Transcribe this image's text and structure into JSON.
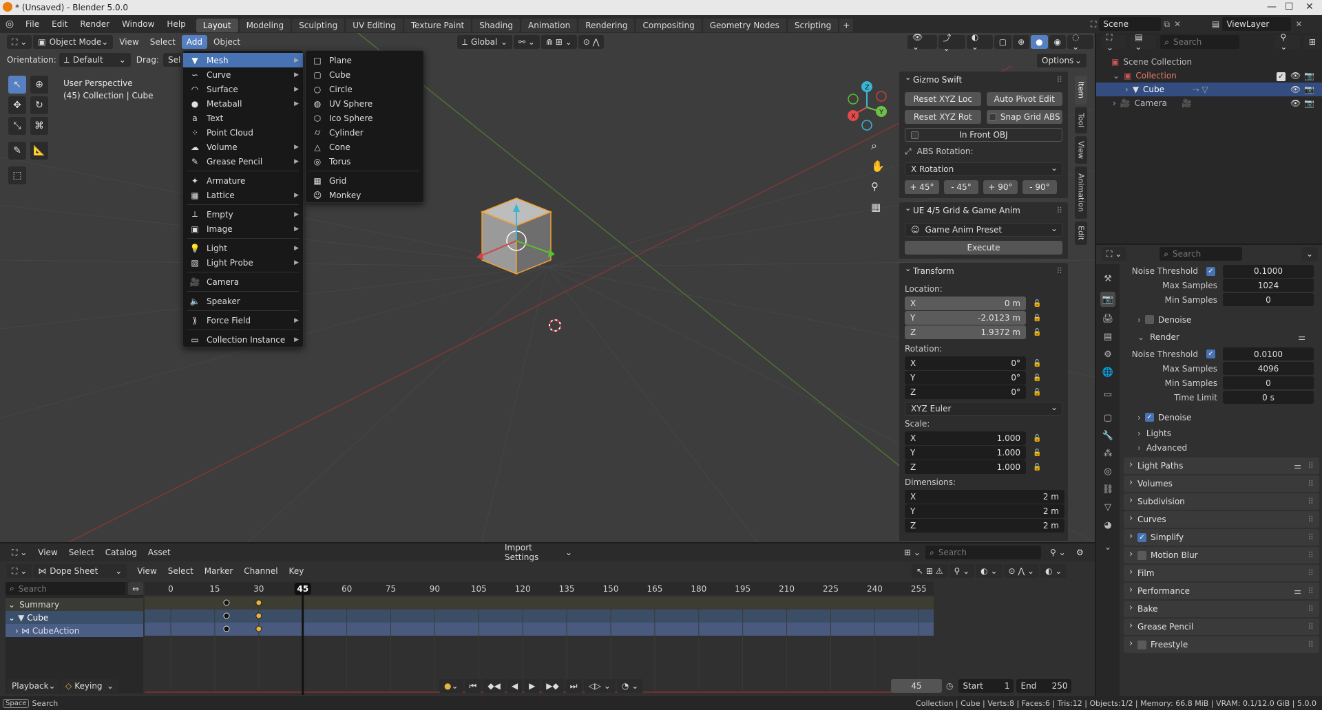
{
  "window": {
    "title": "* (Unsaved) - Blender 5.0.0"
  },
  "topbar": {
    "menus": [
      "File",
      "Edit",
      "Render",
      "Window",
      "Help"
    ],
    "workspaces": [
      "Layout",
      "Modeling",
      "Sculpting",
      "UV Editing",
      "Texture Paint",
      "Shading",
      "Animation",
      "Rendering",
      "Compositing",
      "Geometry Nodes",
      "Scripting"
    ],
    "scene": "Scene",
    "view_layer": "ViewLayer"
  },
  "viewport": {
    "mode": "Object Mode",
    "menus": [
      "View",
      "Select",
      "Add",
      "Object"
    ],
    "orientation_label": "Orientation:",
    "orientation_value": "Default",
    "drag_label": "Drag:",
    "drag_value": "Select",
    "transform_orientation": "Global",
    "options": "Options",
    "info_line1": "User Perspective",
    "info_line2": "(45) Collection | Cube"
  },
  "add_menu": {
    "items": [
      "Mesh",
      "Curve",
      "Surface",
      "Metaball",
      "Text",
      "Point Cloud",
      "Volume",
      "Grease Pencil",
      "Armature",
      "Lattice",
      "Empty",
      "Image",
      "Light",
      "Light Probe",
      "Camera",
      "Speaker",
      "Force Field",
      "Collection Instance"
    ]
  },
  "mesh_menu": {
    "items": [
      "Plane",
      "Cube",
      "Circle",
      "UV Sphere",
      "Ico Sphere",
      "Cylinder",
      "Cone",
      "Torus",
      "Grid",
      "Monkey"
    ]
  },
  "npanel": {
    "tabs": [
      "Item",
      "Tool",
      "View",
      "Animation",
      "Edit"
    ],
    "gizmo": {
      "title": "Gizmo Swift",
      "reset_loc": "Reset XYZ Loc",
      "auto_pivot": "Auto Pivot Edit",
      "reset_rot": "Reset XYZ Rot",
      "snap_grid": "Snap Grid ABS",
      "in_front": "In Front OBJ",
      "abs_rotation": "ABS Rotation:",
      "rotation_axis": "X Rotation",
      "angles": [
        "+ 45°",
        "- 45°",
        "+ 90°",
        "- 90°"
      ]
    },
    "ue": {
      "title": "UE 4/5 Grid & Game Anim",
      "preset": "Game Anim Preset",
      "execute": "Execute"
    },
    "transform": {
      "title": "Transform",
      "location_label": "Location:",
      "location": [
        {
          "axis": "X",
          "value": "0 m"
        },
        {
          "axis": "Y",
          "value": "-2.0123 m"
        },
        {
          "axis": "Z",
          "value": "1.9372 m"
        }
      ],
      "rotation_label": "Rotation:",
      "rotation": [
        {
          "axis": "X",
          "value": "0°"
        },
        {
          "axis": "Y",
          "value": "0°"
        },
        {
          "axis": "Z",
          "value": "0°"
        }
      ],
      "rotation_mode": "XYZ Euler",
      "scale_label": "Scale:",
      "scale": [
        {
          "axis": "X",
          "value": "1.000"
        },
        {
          "axis": "Y",
          "value": "1.000"
        },
        {
          "axis": "Z",
          "value": "1.000"
        }
      ],
      "dimensions_label": "Dimensions:",
      "dimensions": [
        {
          "axis": "X",
          "value": "2 m"
        },
        {
          "axis": "Y",
          "value": "2 m"
        },
        {
          "axis": "Z",
          "value": "2 m"
        }
      ]
    }
  },
  "outliner": {
    "search_placeholder": "Search",
    "scene_collection": "Scene Collection",
    "collection": "Collection",
    "cube": "Cube",
    "camera": "Camera"
  },
  "properties": {
    "search_placeholder": "Search",
    "viewport": {
      "noise_threshold_label": "Noise Threshold",
      "noise_threshold": "0.1000",
      "max_samples_label": "Max Samples",
      "max_samples": "1024",
      "min_samples_label": "Min Samples",
      "min_samples": "0",
      "denoise": "Denoise"
    },
    "render_label": "Render",
    "render": {
      "noise_threshold_label": "Noise Threshold",
      "noise_threshold": "0.0100",
      "max_samples_label": "Max Samples",
      "max_samples": "4096",
      "min_samples_label": "Min Samples",
      "min_samples": "0",
      "time_limit_label": "Time Limit",
      "time_limit": "0 s",
      "denoise": "Denoise"
    },
    "lights": "Lights",
    "advanced": "Advanced",
    "panels": [
      "Light Paths",
      "Volumes",
      "Subdivision",
      "Curves",
      "Simplify",
      "Motion Blur",
      "Film",
      "Performance",
      "Bake",
      "Grease Pencil",
      "Freestyle"
    ]
  },
  "timeline": {
    "menus": [
      "View",
      "Select",
      "Catalog",
      "Asset"
    ],
    "import_settings": "Import Settings",
    "search_placeholder": "Search",
    "editor": "Dope Sheet",
    "dope_menus": [
      "View",
      "Select",
      "Marker",
      "Channel",
      "Key"
    ],
    "channel_search": "Search",
    "channels": {
      "summary": "Summary",
      "cube": "Cube",
      "action": "CubeAction"
    },
    "frame_ticks": [
      "0",
      "15",
      "30",
      "45",
      "60",
      "75",
      "90",
      "105",
      "120",
      "135",
      "150",
      "165",
      "180",
      "195",
      "210",
      "225",
      "240",
      "255"
    ],
    "current_frame": "45",
    "playback": "Playback",
    "keying": "Keying",
    "frame_field": "45",
    "start_label": "Start",
    "start": "1",
    "end_label": "End",
    "end": "250"
  },
  "statusbar": {
    "key": "Space",
    "action": "Search",
    "stats": "Collection | Cube | Verts:8 | Faces:6 | Tris:12 | Objects:1/2 | Memory: 66.8 MiB | VRAM: 0.1/12.0 GiB | 5.0.0"
  }
}
